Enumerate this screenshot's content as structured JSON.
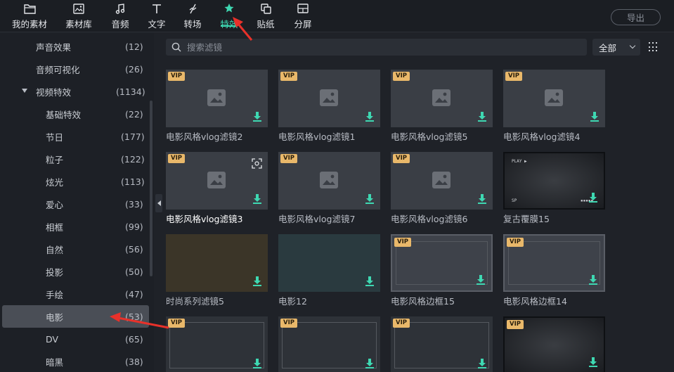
{
  "toolbar": {
    "items": [
      {
        "label": "我的素材",
        "icon": "folder-icon"
      },
      {
        "label": "素材库",
        "icon": "image-library-icon"
      },
      {
        "label": "音频",
        "icon": "music-note-icon"
      },
      {
        "label": "文字",
        "icon": "text-icon"
      },
      {
        "label": "转场",
        "icon": "transition-icon"
      },
      {
        "label": "特效",
        "icon": "effects-star-icon",
        "active": true
      },
      {
        "label": "贴纸",
        "icon": "sticker-icon"
      },
      {
        "label": "分屏",
        "icon": "split-screen-icon"
      }
    ],
    "export_label": "导出"
  },
  "sidebar": {
    "items": [
      {
        "name": "声音效果",
        "count": "(12)"
      },
      {
        "name": "音频可视化",
        "count": "(26)"
      },
      {
        "name": "视频特效",
        "count": "(1134)",
        "expanded": true
      },
      {
        "name": "基础特效",
        "count": "(22)"
      },
      {
        "name": "节日",
        "count": "(177)"
      },
      {
        "name": "粒子",
        "count": "(122)"
      },
      {
        "name": "炫光",
        "count": "(113)"
      },
      {
        "name": "爱心",
        "count": "(33)"
      },
      {
        "name": "相框",
        "count": "(99)"
      },
      {
        "name": "自然",
        "count": "(56)"
      },
      {
        "name": "投影",
        "count": "(50)"
      },
      {
        "name": "手绘",
        "count": "(47)"
      },
      {
        "name": "电影",
        "count": "(53)",
        "selected": true
      },
      {
        "name": "DV",
        "count": "(65)"
      },
      {
        "name": "暗黑",
        "count": "(38)"
      }
    ]
  },
  "search": {
    "placeholder": "搜索滤镜",
    "filter_value": "全部"
  },
  "badge_vip": "VIP",
  "cards": [
    {
      "title": "电影风格vlog滤镜2",
      "vip": true
    },
    {
      "title": "电影风格vlog滤镜1",
      "vip": true
    },
    {
      "title": "电影风格vlog滤镜5",
      "vip": true
    },
    {
      "title": "电影风格vlog滤镜4",
      "vip": true
    },
    {
      "title": "电影风格vlog滤镜3",
      "vip": true,
      "hovered": true
    },
    {
      "title": "电影风格vlog滤镜7",
      "vip": true
    },
    {
      "title": "电影风格vlog滤镜6",
      "vip": true
    },
    {
      "title": "复古覆膜15",
      "vip": false
    },
    {
      "title": "时尚系列滤镜5",
      "vip": false
    },
    {
      "title": "电影12",
      "vip": false
    },
    {
      "title": "电影风格边框15",
      "vip": true
    },
    {
      "title": "电影风格边框14",
      "vip": true
    },
    {
      "title": "",
      "vip": true
    },
    {
      "title": "",
      "vip": true
    },
    {
      "title": "",
      "vip": true
    },
    {
      "title": "",
      "vip": true
    }
  ],
  "vintage_overlay": {
    "top_text": "PLAY ▶",
    "bottom_text": "SP"
  },
  "colors": {
    "accent": "#3ed8b2",
    "vip_badge": "#e9b86a",
    "annotation_arrow": "#e8312a"
  }
}
